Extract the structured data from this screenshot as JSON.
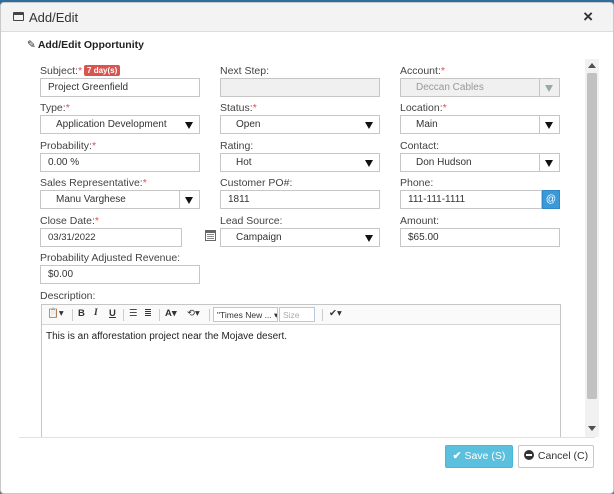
{
  "dialog": {
    "title": "Add/Edit",
    "section_title": "Add/Edit Opportunity",
    "close_glyph": "×"
  },
  "fields": {
    "subject": {
      "label": "Subject:",
      "required": "*",
      "badge": "7 day(s)",
      "value": "Project Greenfield"
    },
    "next_step": {
      "label": "Next Step:",
      "value": ""
    },
    "account": {
      "label": "Account:",
      "required": "*",
      "value": "Deccan Cables"
    },
    "type": {
      "label": "Type:",
      "required": "*",
      "value": "Application Development"
    },
    "status": {
      "label": "Status:",
      "required": "*",
      "value": "Open"
    },
    "location": {
      "label": "Location:",
      "required": "*",
      "value": "Main"
    },
    "probability": {
      "label": "Probability:",
      "required": "*",
      "value": "0.00 %"
    },
    "rating": {
      "label": "Rating:",
      "value": "Hot"
    },
    "contact": {
      "label": "Contact:",
      "value": "Don Hudson"
    },
    "sales_rep": {
      "label": "Sales Representative:",
      "required": "*",
      "value": "Manu Varghese"
    },
    "customer_po": {
      "label": "Customer PO#:",
      "value": "1811"
    },
    "phone": {
      "label": "Phone:",
      "value": "111-111-1111",
      "button_glyph": "@"
    },
    "close_date": {
      "label": "Close Date:",
      "required": "*",
      "value": "03/31/2022"
    },
    "lead_source": {
      "label": "Lead Source:",
      "value": "Campaign"
    },
    "amount": {
      "label": "Amount:",
      "value": "$65.00"
    },
    "prob_adj_revenue": {
      "label": "Probability Adjusted Revenue:",
      "value": "$0.00"
    },
    "description": {
      "label": "Description:",
      "text": "This is an afforestation project near the Mojave desert."
    }
  },
  "editor_toolbar": {
    "bold": "B",
    "italic": "I",
    "underline": "U",
    "font_color": "A",
    "font_name": "\"Times New ...",
    "font_size_placeholder": "Size"
  },
  "buttons": {
    "save": "Save (S)",
    "cancel": "Cancel (C)"
  },
  "colors": {
    "required": "#d9534f",
    "save_button": "#5bc0de",
    "phone_button": "#3a9ad9"
  }
}
